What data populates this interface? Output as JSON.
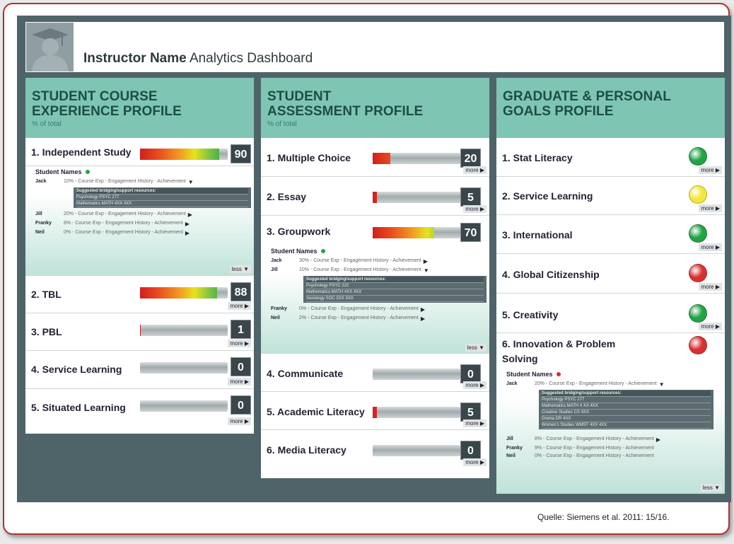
{
  "header": {
    "instructor_label": "Instructor Name",
    "dashboard_label": "Analytics Dashboard"
  },
  "colors": {
    "teal": "#7fc5b3",
    "dark": "#4f6469",
    "green": "#23a246",
    "yellow": "#f4e63a",
    "red": "#d93030"
  },
  "col1": {
    "title1": "STUDENT COURSE",
    "title2": "EXPERIENCE PROFILE",
    "sub": "% of total",
    "rows": [
      {
        "label": "1. Independent Study",
        "value": "90",
        "level": 0.9
      },
      {
        "label": "2. TBL",
        "value": "88",
        "level": 0.88
      },
      {
        "label": "3. PBL",
        "value": "1",
        "level": 0.01
      },
      {
        "label": "4. Service Learning",
        "value": "0",
        "level": 0
      },
      {
        "label": "5. Situated Learning",
        "value": "0",
        "level": 0
      }
    ],
    "expanded": {
      "heading": "Student Names",
      "students": [
        {
          "name": "Jack",
          "text": "10% - Course Exp - Engagement History - Achievement",
          "arrow": "▼"
        },
        {
          "name": "Jill",
          "text": "20% - Course Exp - Engagement History - Achievement",
          "arrow": "▶"
        },
        {
          "name": "Franky",
          "text": "6% - Course Exp - Engagement History - Achievement",
          "arrow": "▶"
        },
        {
          "name": "Neil",
          "text": "0% - Course Exp - Engagement History - Achievement",
          "arrow": "▶"
        }
      ],
      "resources": [
        "Suggested bridging/support resources:",
        "Psychology PSYC 277",
        "Mathematics MATH 4XX 4XX"
      ],
      "less": "less ▼"
    }
  },
  "col2": {
    "title1": "STUDENT",
    "title2": "ASSESSMENT PROFILE",
    "sub": "% of total",
    "rows": [
      {
        "label": "1. Multiple Choice",
        "value": "20",
        "level": 0.2
      },
      {
        "label": "2. Essay",
        "value": "5",
        "level": 0.05
      },
      {
        "label": "3. Groupwork",
        "value": "70",
        "level": 0.7
      },
      {
        "label": "4. Communicate",
        "value": "0",
        "level": 0
      },
      {
        "label": "5. Academic Literacy",
        "value": "5",
        "level": 0.05
      },
      {
        "label": "6. Media Literacy",
        "value": "0",
        "level": 0
      }
    ],
    "expanded": {
      "heading": "Student Names",
      "students": [
        {
          "name": "Jack",
          "text": "30% - Course Exp - Engagement History - Achievement",
          "arrow": "▶"
        },
        {
          "name": "Jill",
          "text": "10% - Course Exp - Engagement History - Achievement",
          "arrow": "▼"
        },
        {
          "name": "Franky",
          "text": "0% - Course Exp - Engagement History - Achievement",
          "arrow": "▶"
        },
        {
          "name": "Neil",
          "text": "2% - Course Exp - Engagement History - Achievement",
          "arrow": "▶"
        }
      ],
      "resources": [
        "Suggested bridging/support resources:",
        "Psychology PSYC 222",
        "Mathematics MATH 4XX 4XX",
        "Sociology SOC 3XX 3XX"
      ],
      "less": "less ▼"
    }
  },
  "col3": {
    "title1": "GRADUATE & PERSONAL",
    "title2": "GOALS PROFILE",
    "rows": [
      {
        "label": "1. Stat Literacy",
        "status": "green"
      },
      {
        "label": "2. Service Learning",
        "status": "yellow"
      },
      {
        "label": "3. International",
        "status": "green"
      },
      {
        "label": "4. Global Citizenship",
        "status": "red"
      },
      {
        "label": "5. Creativity",
        "status": "green"
      },
      {
        "label": "6. Innovation & Problem Solving",
        "status": "red"
      }
    ],
    "expanded": {
      "heading": "Student Names",
      "students": [
        {
          "name": "Jack",
          "text": "20% - Course Exp - Engagement History - Achievement",
          "arrow": "▼"
        },
        {
          "name": "Jill",
          "text": "8% - Course Exp - Engagement History - Achievement",
          "arrow": "▶"
        },
        {
          "name": "Franky",
          "text": "9% - Course Exp - Engagement History - Achievement",
          "arrow": ""
        },
        {
          "name": "Neil",
          "text": "0% - Course Exp - Engagement History - Achievement",
          "arrow": ""
        }
      ],
      "resources": [
        "Suggested bridging/support resources:",
        "Psychology PSYC 277",
        "Mathematics MATH 4 XX 4XX",
        "Creative Studies CS 4XX",
        "Drama DR 4XX",
        "Women's Studies WMST 4XX 4XX"
      ],
      "less": "less ▼"
    }
  },
  "more_label": "more ▶",
  "source": "Quelle: Siemens et al. 2011: 15/16."
}
